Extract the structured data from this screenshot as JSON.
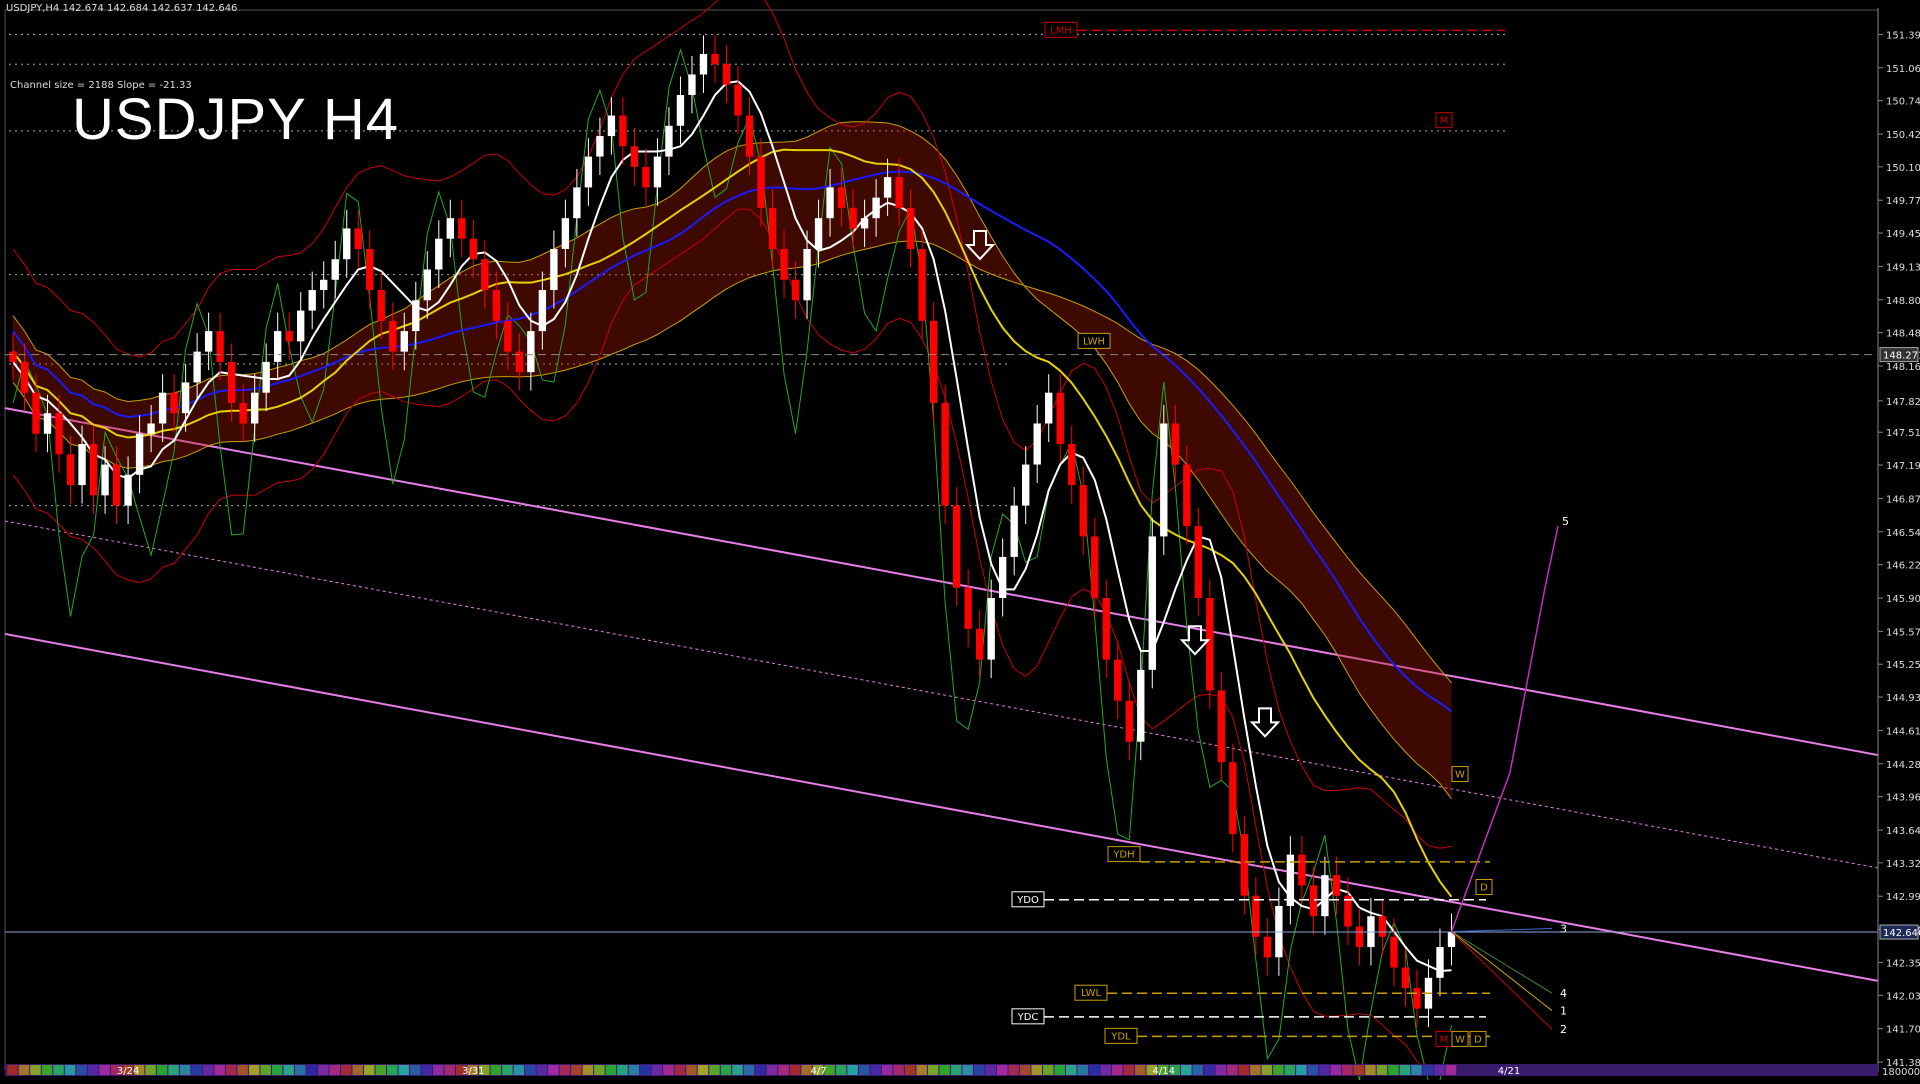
{
  "header": {
    "symbol_line": "USDJPY,H4  142.674 142.684 142.637 142.646",
    "channel_info": "Channel size = 2188 Slope = -21.33",
    "big_title": "USDJPY H4"
  },
  "colors": {
    "background": "#000000",
    "bull_candle": "#ffffff",
    "bear_candle": "#ff0000",
    "ma_blue": "#1a1aff",
    "ma_yellow": "#e6d200",
    "ma_white": "#ffffff",
    "bollinger": "#cc0000",
    "green_line": "#22aa22",
    "channel": "#e87ee8",
    "cloud_bear": "#b01a00",
    "cloud_bull": "#1a3cc8",
    "cloud_edge": "#c8a000"
  },
  "chart_data": {
    "type": "candlestick",
    "ylim": [
      141.38,
      151.55
    ],
    "y_ticks": [
      "151.390",
      "151.065",
      "150.745",
      "150.420",
      "150.100",
      "149.775",
      "149.455",
      "149.130",
      "148.805",
      "148.485",
      "148.160",
      "147.820",
      "147.515",
      "147.195",
      "146.870",
      "146.545",
      "146.225",
      "145.900",
      "145.575",
      "145.255",
      "144.935",
      "144.610",
      "144.285",
      "143.965",
      "143.640",
      "143.320",
      "142.995",
      "142.670",
      "142.350",
      "142.030",
      "141.705",
      "141.380"
    ],
    "x_ticks": [
      "3/24",
      "3/31",
      "4/7",
      "4/14",
      "4/21"
    ],
    "x_tick_index": [
      10,
      40,
      70,
      100,
      130
    ],
    "current_price": "142.646",
    "marked_price": "148.271",
    "bottom_right_label": "180000",
    "close_series": [
      148.2,
      147.9,
      147.5,
      147.7,
      147.3,
      147.0,
      147.4,
      146.9,
      147.2,
      146.8,
      147.1,
      147.5,
      147.6,
      147.9,
      147.7,
      148.0,
      148.3,
      148.5,
      148.2,
      147.8,
      147.6,
      147.9,
      148.2,
      148.5,
      148.4,
      148.7,
      148.9,
      149.0,
      149.2,
      149.5,
      149.3,
      148.9,
      148.6,
      148.3,
      148.5,
      148.8,
      149.1,
      149.4,
      149.6,
      149.4,
      149.2,
      148.9,
      148.6,
      148.3,
      148.1,
      148.5,
      148.9,
      149.3,
      149.6,
      149.9,
      150.2,
      150.4,
      150.6,
      150.3,
      150.1,
      149.9,
      150.2,
      150.5,
      150.8,
      151.0,
      151.2,
      151.1,
      150.9,
      150.6,
      150.2,
      149.7,
      149.3,
      149.0,
      148.8,
      149.3,
      149.6,
      149.9,
      149.7,
      149.5,
      149.6,
      149.8,
      150.0,
      149.7,
      149.3,
      148.6,
      147.8,
      146.8,
      146.0,
      145.6,
      145.3,
      145.9,
      146.3,
      146.8,
      147.2,
      147.6,
      147.9,
      147.4,
      147.0,
      146.5,
      145.9,
      145.3,
      144.9,
      144.5,
      145.2,
      146.5,
      147.6,
      147.2,
      146.6,
      145.9,
      145.0,
      144.3,
      143.6,
      143.0,
      142.6,
      142.4,
      142.9,
      143.4,
      143.1,
      142.8,
      143.2,
      143.0,
      142.7,
      142.5,
      142.8,
      142.6,
      142.3,
      142.1,
      141.9,
      142.2,
      142.5,
      142.646
    ],
    "drawing_labels": {
      "lmh": "LMH",
      "m_upper": "M",
      "lwh": "LWH",
      "lwl": "LWL",
      "w_label": "W",
      "ydh": "YDH",
      "ydo": "YDO",
      "ydc": "YDC",
      "ydl": "YDL",
      "d_upper": "D",
      "m_low": "M",
      "w_low": "W",
      "d_low": "D",
      "projection_5": "5",
      "projection_3": "3",
      "projection_4": "4",
      "projection_1": "1",
      "projection_2": "2"
    }
  }
}
